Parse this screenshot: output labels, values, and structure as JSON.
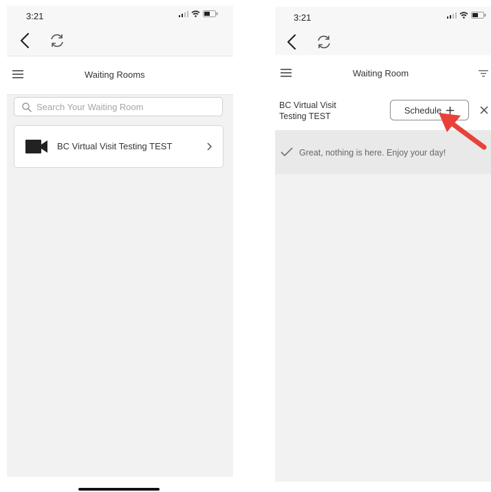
{
  "left_screen": {
    "status_time": "3:21",
    "header_title": "Waiting Rooms",
    "search": {
      "placeholder": "Search Your Waiting Room",
      "value": ""
    },
    "rooms": [
      {
        "name": "BC Virtual Visit Testing TEST"
      }
    ]
  },
  "right_screen": {
    "status_time": "3:21",
    "header_title": "Waiting Room",
    "visit": {
      "name_line1": "BC Virtual Visit",
      "name_line2": "Testing TEST",
      "schedule_label": "Schedule"
    },
    "empty_message": "Great, nothing is here. Enjoy your day!"
  },
  "icons": {
    "back": "chevron-left-icon",
    "refresh": "refresh-icon",
    "menu": "hamburger-menu-icon",
    "search": "search-icon",
    "camera": "video-camera-icon",
    "chevron": "chevron-right-icon",
    "plus": "plus-icon",
    "close": "close-icon",
    "check": "check-icon",
    "filter": "filter-icon"
  },
  "colors": {
    "app_background": "#f2f2f2",
    "card_background": "#ffffff",
    "annotation_arrow": "#e8413a"
  }
}
